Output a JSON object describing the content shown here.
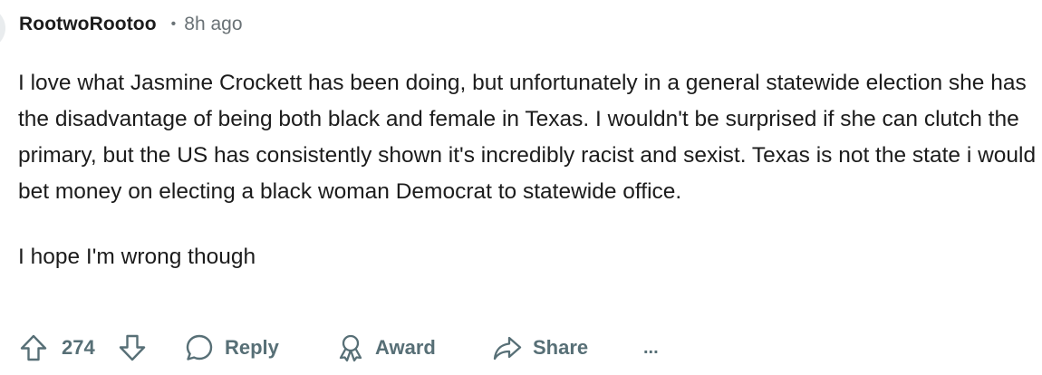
{
  "comment": {
    "author": "RootwoRootoo",
    "separator": "•",
    "time_ago": "8h ago",
    "paragraphs": [
      "I love what Jasmine Crockett has been doing, but unfortunately in a general statewide election she has the disadvantage of being both black and female in Texas. I wouldn't be surprised if she can clutch the primary, but the US has consistently shown it's incredibly racist and sexist. Texas is not the state i would bet money on electing a black woman Democrat to statewide office.",
      "I hope I'm wrong though"
    ]
  },
  "actions": {
    "vote_count": "274",
    "reply_label": "Reply",
    "award_label": "Award",
    "share_label": "Share",
    "more_label": "..."
  },
  "icons": {
    "upvote": "upvote-arrow-icon",
    "downvote": "downvote-arrow-icon",
    "reply": "speech-bubble-icon",
    "award": "award-ribbon-icon",
    "share": "share-arrow-icon",
    "more": "ellipsis-icon"
  },
  "colors": {
    "text": "#1c1c1c",
    "meta": "#6a7276",
    "action": "#576f76"
  }
}
